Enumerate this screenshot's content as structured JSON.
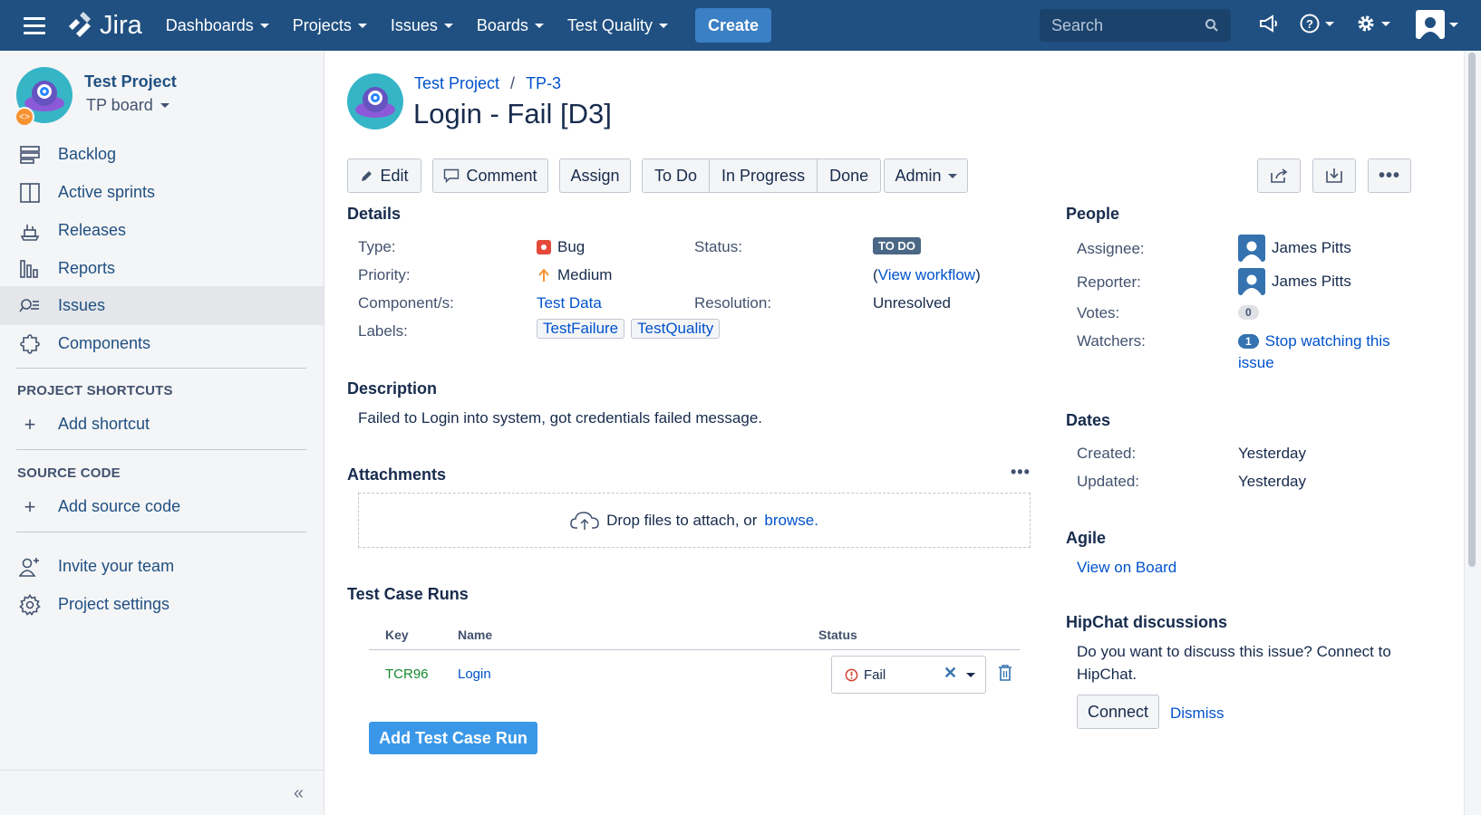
{
  "topnav": {
    "logo_text": "Jira",
    "items": [
      {
        "label": "Dashboards"
      },
      {
        "label": "Projects"
      },
      {
        "label": "Issues"
      },
      {
        "label": "Boards"
      },
      {
        "label": "Test Quality"
      }
    ],
    "create_label": "Create",
    "search_placeholder": "Search",
    "icons": [
      "hamburger-icon",
      "feedback-megaphone-icon",
      "help-icon",
      "settings-gear-icon",
      "user-avatar-icon"
    ],
    "brand_color": "#205081"
  },
  "sidebar": {
    "project_name": "Test Project",
    "board_name": "TP board",
    "items": [
      {
        "label": "Backlog",
        "icon": "backlog-icon"
      },
      {
        "label": "Active sprints",
        "icon": "active-sprints-icon"
      },
      {
        "label": "Releases",
        "icon": "releases-icon"
      },
      {
        "label": "Reports",
        "icon": "reports-icon"
      },
      {
        "label": "Issues",
        "icon": "issues-icon",
        "active": true
      },
      {
        "label": "Components",
        "icon": "components-icon"
      }
    ],
    "shortcuts_heading": "PROJECT SHORTCUTS",
    "add_shortcut": "Add shortcut",
    "source_heading": "SOURCE CODE",
    "add_source": "Add source code",
    "invite": "Invite your team",
    "settings": "Project settings"
  },
  "issue": {
    "breadcrumb_project": "Test Project",
    "breadcrumb_sep": "/",
    "key": "TP-3",
    "title": "Login - Fail [D3]",
    "actions": {
      "edit": "Edit",
      "comment": "Comment",
      "assign": "Assign",
      "workflow": [
        "To Do",
        "In Progress",
        "Done"
      ],
      "admin": "Admin"
    },
    "details": {
      "heading": "Details",
      "type_label": "Type:",
      "type_value": "Bug",
      "priority_label": "Priority:",
      "priority_value": "Medium",
      "components_label": "Component/s:",
      "components_value": "Test Data",
      "labels_label": "Labels:",
      "labels": [
        "TestFailure",
        "TestQuality"
      ],
      "status_label": "Status:",
      "status_value": "TO DO",
      "view_workflow": "View workflow",
      "resolution_label": "Resolution:",
      "resolution_value": "Unresolved"
    },
    "description": {
      "heading": "Description",
      "text": "Failed to Login into system, got credentials failed message."
    },
    "attachments": {
      "heading": "Attachments",
      "drop_text": "Drop files to attach, or",
      "browse": "browse."
    },
    "test_case_runs": {
      "heading": "Test Case Runs",
      "columns": [
        "Key",
        "Name",
        "Status"
      ],
      "rows": [
        {
          "key": "TCR96",
          "name": "Login",
          "status": "Fail"
        }
      ],
      "add_button": "Add Test Case Run"
    }
  },
  "people": {
    "heading": "People",
    "assignee_label": "Assignee:",
    "assignee": "James Pitts",
    "reporter_label": "Reporter:",
    "reporter": "James Pitts",
    "votes_label": "Votes:",
    "votes": "0",
    "watchers_label": "Watchers:",
    "watchers": "1",
    "stop_watching_1": "Stop watching this",
    "stop_watching_2": "issue"
  },
  "dates": {
    "heading": "Dates",
    "created_label": "Created:",
    "created": "Yesterday",
    "updated_label": "Updated:",
    "updated": "Yesterday"
  },
  "agile": {
    "heading": "Agile",
    "view_on_board": "View on Board"
  },
  "hipchat": {
    "heading": "HipChat discussions",
    "text_1": "Do you want to discuss this issue? Connect to",
    "text_2": "HipChat.",
    "connect": "Connect",
    "dismiss": "Dismiss"
  }
}
